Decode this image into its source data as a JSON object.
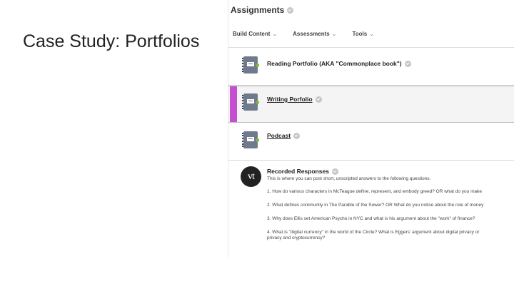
{
  "slide": {
    "title": "Case Study: Portfolios"
  },
  "header": {
    "title": "Assignments"
  },
  "menu": [
    {
      "label": "Build Content"
    },
    {
      "label": "Assessments"
    },
    {
      "label": "Tools"
    }
  ],
  "items": [
    {
      "title": "Reading Portfolio (AKA \"Commonplace book\")"
    },
    {
      "title": "Writing Porfolio"
    },
    {
      "title": "Podcast"
    }
  ],
  "recorded": {
    "title": "Recorded Responses",
    "logo_text": "vt",
    "description": "This is where you can post short, unscripted answers to the following questions.",
    "questions": [
      {
        "line1": "1. How do various characters in McTeague define, represent, and embody greed? OR what do you make"
      },
      {
        "line1": "2. What defines community in The Parable of the Sower? OR What do you notice about the role of money"
      },
      {
        "line1": "3. Why does Ellis set American Psycho in NYC and what is his argument about the \"work\" of finance?"
      },
      {
        "line1": "4. What is \"digital currency\" in the world of the Circle? What is Eggers' argument about digital privacy or",
        "line2": "privacy and cryptocurrency?"
      }
    ]
  },
  "colors": {
    "selected_accent": "#c44fd1",
    "status_dot": "#79b539",
    "notebook": "#6f7a8c"
  },
  "icons": {
    "item_icon": "notebook-icon",
    "status": "check-circle-icon",
    "menu_caret": "chevron-down-icon"
  }
}
